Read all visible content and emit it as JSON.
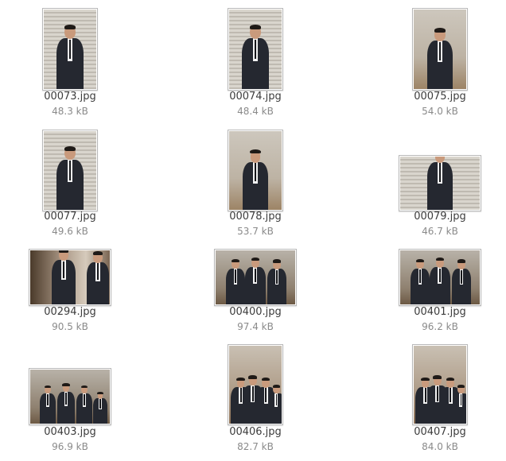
{
  "files": [
    {
      "name": "00073.jpg",
      "size": "48.3 kB",
      "scene": "blinds-single"
    },
    {
      "name": "00074.jpg",
      "size": "48.4 kB",
      "scene": "blinds-single"
    },
    {
      "name": "00075.jpg",
      "size": "54.0 kB",
      "scene": "room-single"
    },
    {
      "name": "00077.jpg",
      "size": "49.6 kB",
      "scene": "blinds-single"
    },
    {
      "name": "00078.jpg",
      "size": "53.7 kB",
      "scene": "room-single"
    },
    {
      "name": "00079.jpg",
      "size": "46.7 kB",
      "scene": "blinds-closeup"
    },
    {
      "name": "00294.jpg",
      "size": "90.5 kB",
      "scene": "party-closeup"
    },
    {
      "name": "00400.jpg",
      "size": "97.4 kB",
      "scene": "group-three"
    },
    {
      "name": "00401.jpg",
      "size": "96.2 kB",
      "scene": "group-three"
    },
    {
      "name": "00403.jpg",
      "size": "96.9 kB",
      "scene": "group-four"
    },
    {
      "name": "00406.jpg",
      "size": "82.7 kB",
      "scene": "hall-group"
    },
    {
      "name": "00407.jpg",
      "size": "84.0 kB",
      "scene": "hall-group"
    }
  ]
}
